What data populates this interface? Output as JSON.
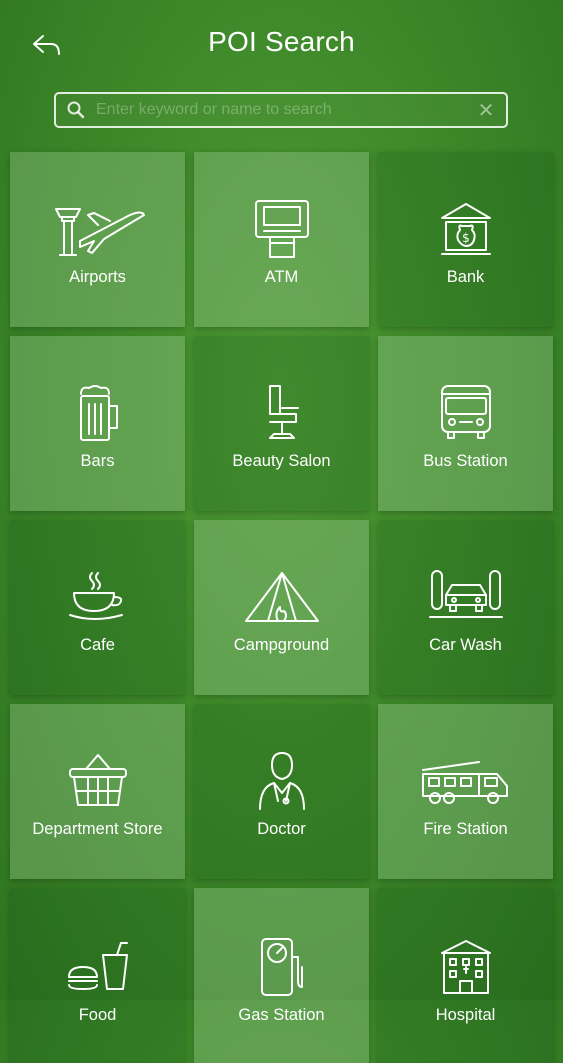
{
  "header": {
    "title": "POI Search"
  },
  "search": {
    "placeholder": "Enter keyword or name to search",
    "clear_symbol": "✕"
  },
  "categories": [
    {
      "label": "Airports",
      "icon": "airport-icon"
    },
    {
      "label": "ATM",
      "icon": "atm-icon"
    },
    {
      "label": "Bank",
      "icon": "bank-icon"
    },
    {
      "label": "Bars",
      "icon": "beer-mug-icon"
    },
    {
      "label": "Beauty Salon",
      "icon": "salon-chair-icon"
    },
    {
      "label": "Bus Station",
      "icon": "bus-icon"
    },
    {
      "label": "Cafe",
      "icon": "coffee-cup-icon"
    },
    {
      "label": "Campground",
      "icon": "tent-icon"
    },
    {
      "label": "Car Wash",
      "icon": "car-wash-icon"
    },
    {
      "label": "Department Store",
      "icon": "shopping-basket-icon"
    },
    {
      "label": "Doctor",
      "icon": "doctor-icon"
    },
    {
      "label": "Fire Station",
      "icon": "fire-truck-icon"
    },
    {
      "label": "Food",
      "icon": "fast-food-icon"
    },
    {
      "label": "Gas Station",
      "icon": "gas-pump-icon"
    },
    {
      "label": "Hospital",
      "icon": "hospital-icon"
    }
  ]
}
